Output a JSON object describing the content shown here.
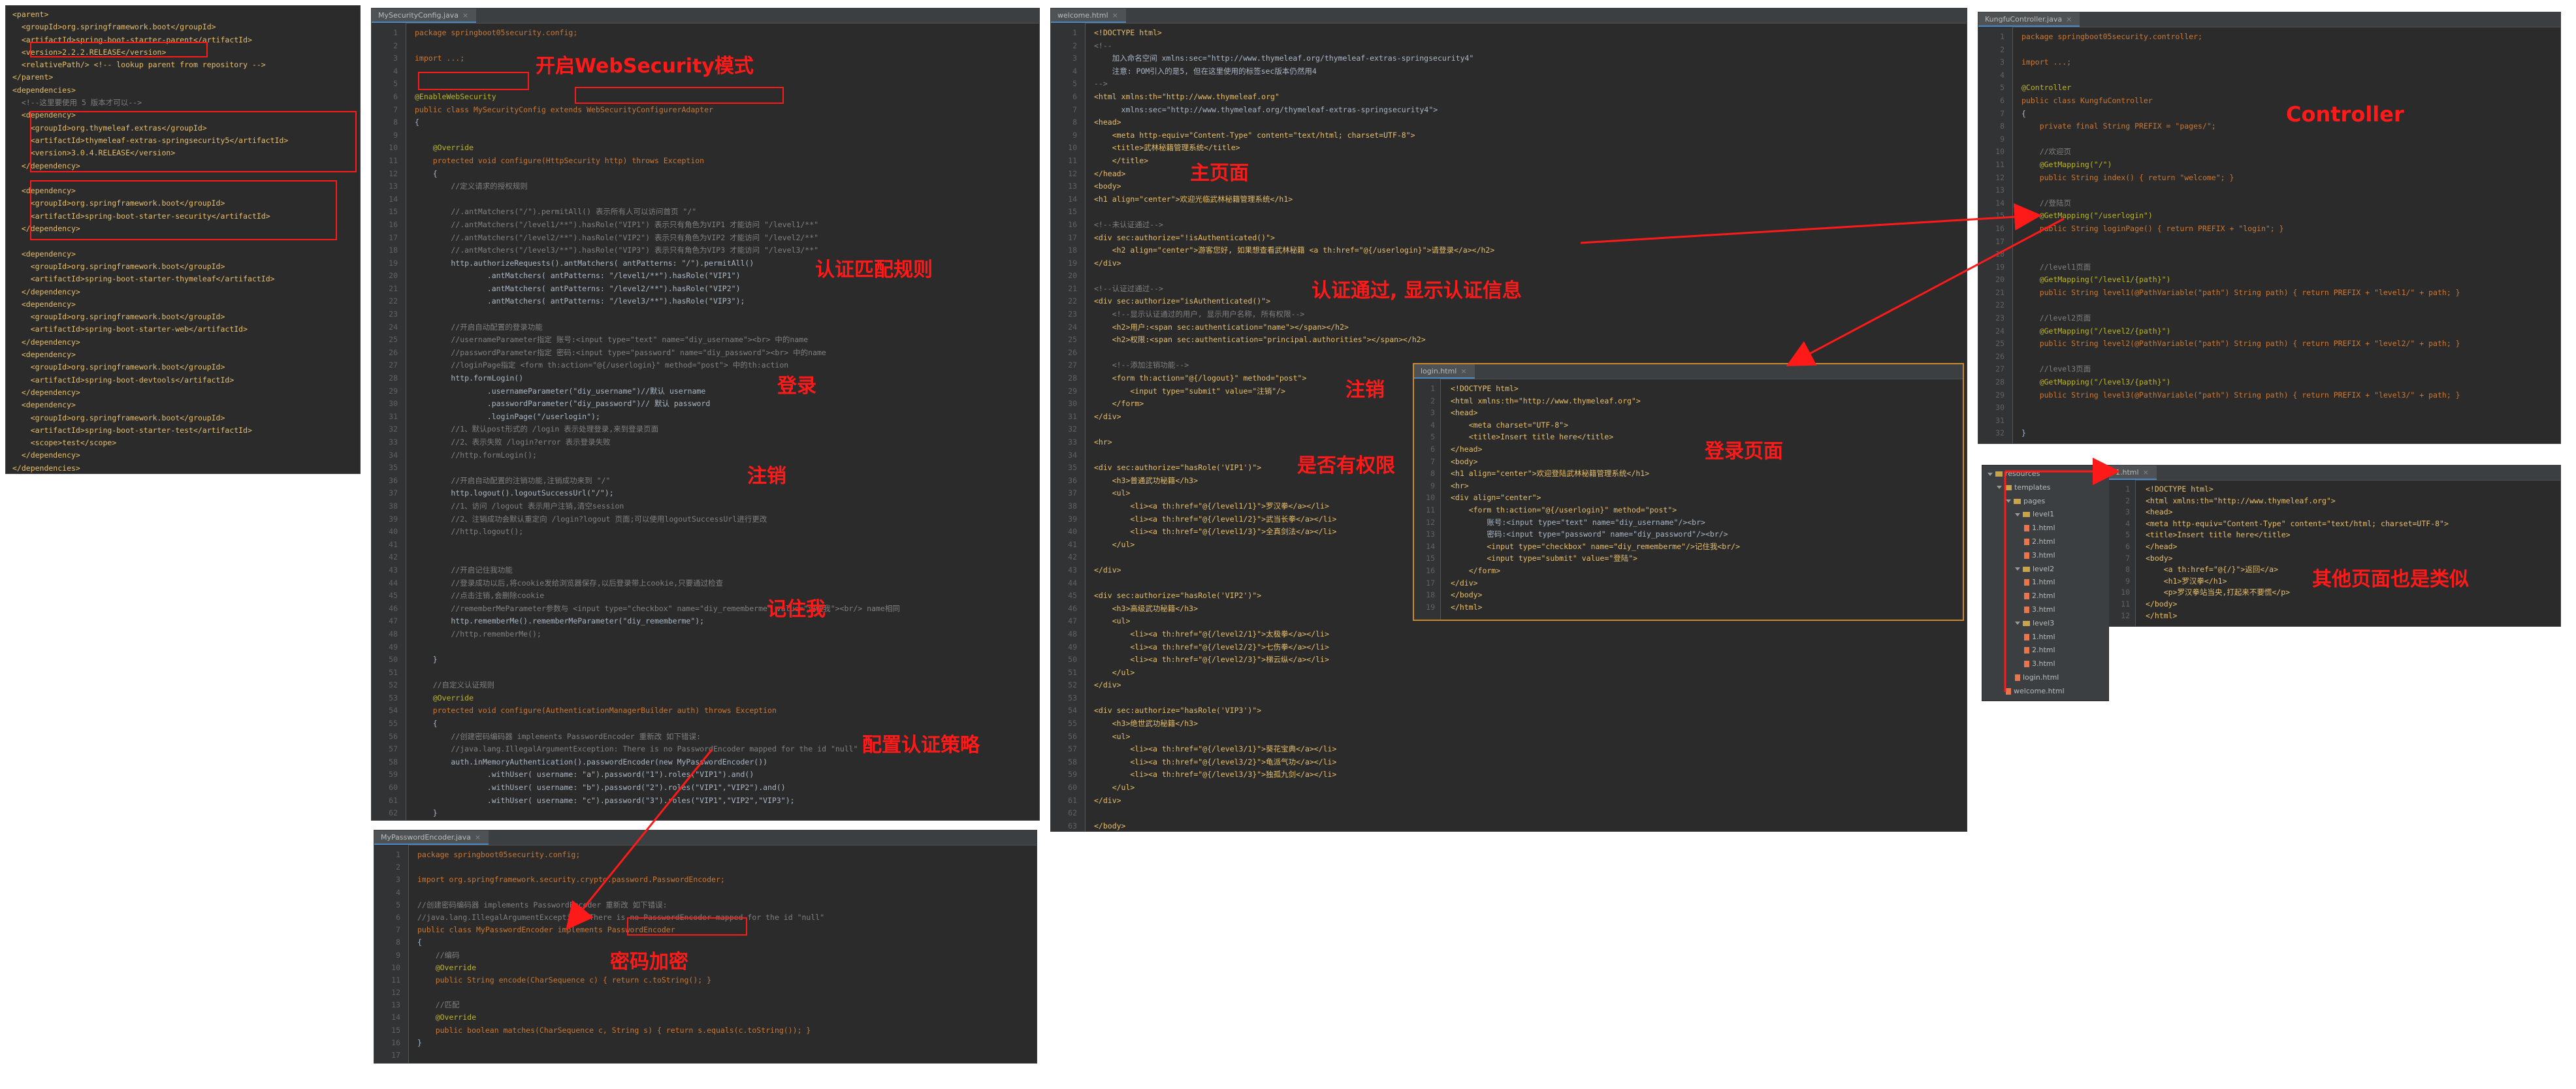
{
  "tabs": {
    "security_config": "MySecurityConfig.java",
    "welcome": "welcome.html",
    "controller": "KungfuController.java",
    "login": "login.html",
    "password_encoder": "MyPasswordEncoder.java",
    "one_html": "1.html"
  },
  "pom_lines": [
    "<parent>",
    "  <groupId>org.springframework.boot</groupId>",
    "  <artifactId>spring-boot-starter-parent</artifactId>",
    "  <version>2.2.2.RELEASE</version>",
    "  <relativePath/> <!-- lookup parent from repository -->",
    "</parent>",
    "<dependencies>",
    "  <!--这里要使用 5 版本才可以-->",
    "  <dependency>",
    "    <groupId>org.thymeleaf.extras</groupId>",
    "    <artifactId>thymeleaf-extras-springsecurity5</artifactId>",
    "    <version>3.0.4.RELEASE</version>",
    "  </dependency>",
    "",
    "  <dependency>",
    "    <groupId>org.springframework.boot</groupId>",
    "    <artifactId>spring-boot-starter-security</artifactId>",
    "  </dependency>",
    "",
    "  <dependency>",
    "    <groupId>org.springframework.boot</groupId>",
    "    <artifactId>spring-boot-starter-thymeleaf</artifactId>",
    "  </dependency>",
    "  <dependency>",
    "    <groupId>org.springframework.boot</groupId>",
    "    <artifactId>spring-boot-starter-web</artifactId>",
    "  </dependency>",
    "  <dependency>",
    "    <groupId>org.springframework.boot</groupId>",
    "    <artifactId>spring-boot-devtools</artifactId>",
    "  </dependency>",
    "  <dependency>",
    "    <groupId>org.springframework.boot</groupId>",
    "    <artifactId>spring-boot-starter-test</artifactId>",
    "    <scope>test</scope>",
    "  </dependency>",
    "</dependencies>"
  ],
  "security_lines": [
    "package springboot05security.config;",
    "",
    "import ...;",
    "",
    "",
    "@EnableWebSecurity",
    "public class MySecurityConfig extends WebSecurityConfigurerAdapter",
    "{",
    "",
    "    @Override",
    "    protected void configure(HttpSecurity http) throws Exception",
    "    {",
    "        //定义请求的授权规则",
    "",
    "        //.antMatchers(\"/\").permitAll() 表示所有人可以访问首页 \"/\"",
    "        //.antMatchers(\"/level1/**\").hasRole(\"VIP1\") 表示只有角色为VIP1 才能访问 \"/level1/**\"",
    "        //.antMatchers(\"/level2/**\").hasRole(\"VIP2\") 表示只有角色为VIP2 才能访问 \"/level2/**\"",
    "        //.antMatchers(\"/level3/**\").hasRole(\"VIP3\") 表示只有角色为VIP3 才能访问 \"/level3/**\"",
    "        http.authorizeRequests().antMatchers( antPatterns: \"/\").permitAll()",
    "                .antMatchers( antPatterns: \"/level1/**\").hasRole(\"VIP1\")",
    "                .antMatchers( antPatterns: \"/level2/**\").hasRole(\"VIP2\")",
    "                .antMatchers( antPatterns: \"/level3/**\").hasRole(\"VIP3\");",
    "",
    "        //开启自动配置的登录功能",
    "        //usernameParameter指定 账号:<input type=\"text\" name=\"diy_username\"><br> 中的name",
    "        //passwordParameter指定 密码:<input type=\"password\" name=\"diy_password\"><br> 中的name",
    "        //loginPage指定 <form th:action=\"@{/userlogin}\" method=\"post\"> 中的th:action",
    "        http.formLogin()",
    "                .usernameParameter(\"diy_username\")//默认 username",
    "                .passwordParameter(\"diy_password\")// 默认 password",
    "                .loginPage(\"/userlogin\");",
    "        //1、默认post形式的 /login 表示处理登录,来到登录页面",
    "        //2、表示失败 /login?error 表示登录失败",
    "        //http.formLogin();",
    "",
    "        //开启自动配置的注销功能,注销成功来到 \"/\"",
    "        http.logout().logoutSuccessUrl(\"/\");",
    "        //1、访问 /logout 表示用户注销,清空session",
    "        //2、注销成功会默认重定向 /login?logout 页面;可以使用logoutSuccessUrl进行更改",
    "        //http.logout();",
    "",
    "",
    "        //开启记住我功能",
    "        //登录成功以后,将cookie发给浏览器保存,以后登录带上cookie,只要通过检查",
    "        //点击注销,会删除cookie",
    "        //rememberMeParameter参数与 <input type=\"checkbox\" name=\"diy_rememberme\" value=\"记住我\"><br/> name相同",
    "        http.rememberMe().rememberMeParameter(\"diy_rememberme\");",
    "        //http.rememberMe();",
    "",
    "    }",
    "",
    "    //自定义认证规则",
    "    @Override",
    "    protected void configure(AuthenticationManagerBuilder auth) throws Exception",
    "    {",
    "        //创建密码编码器 implements PasswordEncoder 重新改 如下错误:",
    "        //java.lang.IllegalArgumentException: There is no PasswordEncoder mapped for the id \"null\"",
    "        auth.inMemoryAuthentication().passwordEncoder(new MyPasswordEncoder())",
    "                .withUser( username: \"a\").password(\"1\").roles(\"VIP1\").and()",
    "                .withUser( username: \"b\").password(\"2\").roles(\"VIP1\",\"VIP2\").and()",
    "                .withUser( username: \"c\").password(\"3\").roles(\"VIP1\",\"VIP2\",\"VIP3\");",
    "    }",
    "}"
  ],
  "welcome_lines": [
    "<!DOCTYPE html>",
    "<!--",
    "    加入命名空间 xmlns:sec=\"http://www.thymeleaf.org/thymeleaf-extras-springsecurity4\"",
    "    注意: POM引入的是5, 但在这里使用的标签sec版本仍然用4",
    "-->",
    "<html xmlns:th=\"http://www.thymeleaf.org\"",
    "      xmlns:sec=\"http://www.thymeleaf.org/thymeleaf-extras-springsecurity4\">",
    "<head>",
    "    <meta http-equiv=\"Content-Type\" content=\"text/html; charset=UTF-8\">",
    "    <title>武林秘籍管理系统</title>",
    "    </title>",
    "</head>",
    "<body>",
    "<h1 align=\"center\">欢迎光临武林秘籍管理系统</h1>",
    "",
    "<!--未认证通过-->",
    "<div sec:authorize=\"!isAuthenticated()\">",
    "    <h2 align=\"center\">游客您好, 如果想查看武林秘籍 <a th:href=\"@{/userlogin}\">请登录</a></h2>",
    "</div>",
    "",
    "<!--认证过通过-->",
    "<div sec:authorize=\"isAuthenticated()\">",
    "    <!--显示认证通过的用户, 显示用户名称, 所有权限-->",
    "    <h2>用户:<span sec:authentication=\"name\"></span></h2>",
    "    <h2>权限:<span sec:authentication=\"principal.authorities\"></span></h2>",
    "",
    "    <!--添加注销功能-->",
    "    <form th:action=\"@{/logout}\" method=\"post\">",
    "        <input type=\"submit\" value=\"注销\"/>",
    "    </form>",
    "</div>",
    "",
    "<hr>",
    "",
    "<div sec:authorize=\"hasRole('VIP1')\">",
    "    <h3>普通武功秘籍</h3>",
    "    <ul>",
    "        <li><a th:href=\"@{/level1/1}\">罗汉拳</a></li>",
    "        <li><a th:href=\"@{/level1/2}\">武当长拳</a></li>",
    "        <li><a th:href=\"@{/level1/3}\">全真剑法</a></li>",
    "    </ul>",
    "",
    "</div>",
    "",
    "<div sec:authorize=\"hasRole('VIP2')\">",
    "    <h3>高级武功秘籍</h3>",
    "    <ul>",
    "        <li><a th:href=\"@{/level2/1}\">太极拳</a></li>",
    "        <li><a th:href=\"@{/level2/2}\">七伤拳</a></li>",
    "        <li><a th:href=\"@{/level2/3}\">梯云纵</a></li>",
    "    </ul>",
    "</div>",
    "",
    "<div sec:authorize=\"hasRole('VIP3')\">",
    "    <h3>绝世武功秘籍</h3>",
    "    <ul>",
    "        <li><a th:href=\"@{/level3/1}\">葵花宝典</a></li>",
    "        <li><a th:href=\"@{/level3/2}\">龟派气功</a></li>",
    "        <li><a th:href=\"@{/level3/3}\">独孤九剑</a></li>",
    "    </ul>",
    "</div>",
    "",
    "</body>",
    "</html>"
  ],
  "controller_lines": [
    "package springboot05security.controller;",
    "",
    "import ...;",
    "",
    "@Controller",
    "public class KungfuController",
    "{",
    "    private final String PREFIX = \"pages/\";",
    "",
    "    //欢迎页",
    "    @GetMapping(\"/\")",
    "    public String index() { return \"welcome\"; }",
    "",
    "    //登陆页",
    "    @GetMapping(\"/userlogin\")",
    "    public String loginPage() { return PREFIX + \"login\"; }",
    "",
    "",
    "    //level1页面",
    "    @GetMapping(\"/level1/{path}\")",
    "    public String level1(@PathVariable(\"path\") String path) { return PREFIX + \"level1/\" + path; }",
    "",
    "    //level2页面",
    "    @GetMapping(\"/level2/{path}\")",
    "    public String level2(@PathVariable(\"path\") String path) { return PREFIX + \"level2/\" + path; }",
    "",
    "    //level3页面",
    "    @GetMapping(\"/level3/{path}\")",
    "    public String level3(@PathVariable(\"path\") String path) { return PREFIX + \"level3/\" + path; }",
    "",
    "",
    "}"
  ],
  "login_lines": [
    "<!DOCTYPE html>",
    "<html xmlns:th=\"http://www.thymeleaf.org\">",
    "<head>",
    "    <meta charset=\"UTF-8\">",
    "    <title>Insert title here</title>",
    "</head>",
    "<body>",
    "<h1 align=\"center\">欢迎登陆武林秘籍管理系统</h1>",
    "<hr>",
    "<div align=\"center\">",
    "    <form th:action=\"@{/userlogin}\" method=\"post\">",
    "        账号:<input type=\"text\" name=\"diy_username\"/><br>",
    "        密码:<input type=\"password\" name=\"diy_password\"/><br/>",
    "        <input type=\"checkbox\" name=\"diy_rememberme\"/>记住我<br/>",
    "        <input type=\"submit\" value=\"登陆\">",
    "    </form>",
    "</div>",
    "</body>",
    "</html>"
  ],
  "encoder_lines": [
    "package springboot05security.config;",
    "",
    "import org.springframework.security.crypto.password.PasswordEncoder;",
    "",
    "//创建密码编码器 implements PasswordEncoder 重新改 如下错误:",
    "//java.lang.IllegalArgumentException: There is no PasswordEncoder mapped for the id \"null\"",
    "public class MyPasswordEncoder implements PasswordEncoder",
    "{",
    "    //编码",
    "    @Override",
    "    public String encode(CharSequence c) { return c.toString(); }",
    "",
    "    //匹配",
    "    @Override",
    "    public boolean matches(CharSequence c, String s) { return s.equals(c.toString()); }",
    "}",
    ""
  ],
  "one_html_lines": [
    "<!DOCTYPE html>",
    "<html xmlns:th=\"http://www.thymeleaf.org\">",
    "<head>",
    "<meta http-equiv=\"Content-Type\" content=\"text/html; charset=UTF-8\">",
    "<title>Insert title here</title>",
    "</head>",
    "<body>",
    "    <a th:href=\"@{/}\">返回</a>",
    "    <h1>罗汉拳</h1>",
    "    <p>罗汉拳站当央,打起来不要慌</p>",
    "</body>",
    "</html>"
  ],
  "project_tree": [
    {
      "label": "resources",
      "depth": 0,
      "kind": "folder"
    },
    {
      "label": "templates",
      "depth": 1,
      "kind": "folder"
    },
    {
      "label": "pages",
      "depth": 2,
      "kind": "folder"
    },
    {
      "label": "level1",
      "depth": 3,
      "kind": "folder"
    },
    {
      "label": "1.html",
      "depth": 4,
      "kind": "file"
    },
    {
      "label": "2.html",
      "depth": 4,
      "kind": "file"
    },
    {
      "label": "3.html",
      "depth": 4,
      "kind": "file"
    },
    {
      "label": "level2",
      "depth": 3,
      "kind": "folder"
    },
    {
      "label": "1.html",
      "depth": 4,
      "kind": "file"
    },
    {
      "label": "2.html",
      "depth": 4,
      "kind": "file"
    },
    {
      "label": "3.html",
      "depth": 4,
      "kind": "file"
    },
    {
      "label": "level3",
      "depth": 3,
      "kind": "folder"
    },
    {
      "label": "1.html",
      "depth": 4,
      "kind": "file"
    },
    {
      "label": "2.html",
      "depth": 4,
      "kind": "file"
    },
    {
      "label": "3.html",
      "depth": 4,
      "kind": "file"
    },
    {
      "label": "login.html",
      "depth": 3,
      "kind": "file"
    },
    {
      "label": "welcome.html",
      "depth": 2,
      "kind": "file"
    }
  ],
  "annotations": {
    "enable_websecurity": "开启WebSecurity模式",
    "match_rules": "认证匹配规则",
    "login": "登录",
    "logout_sec": "注销",
    "remember_me": "记住我",
    "auth_strategy": "配置认证策略",
    "password_encrypt": "密码加密",
    "main_page": "主页面",
    "auth_passed": "认证通过, 显示认证信息",
    "logout_welcome": "注销",
    "has_permission": "是否有权限",
    "login_page": "登录页面",
    "controller": "Controller",
    "other_pages": "其他页面也是类似"
  },
  "colors": {
    "editor_bg": "#2b2b2b",
    "annotation_red": "#ff1a1a"
  }
}
